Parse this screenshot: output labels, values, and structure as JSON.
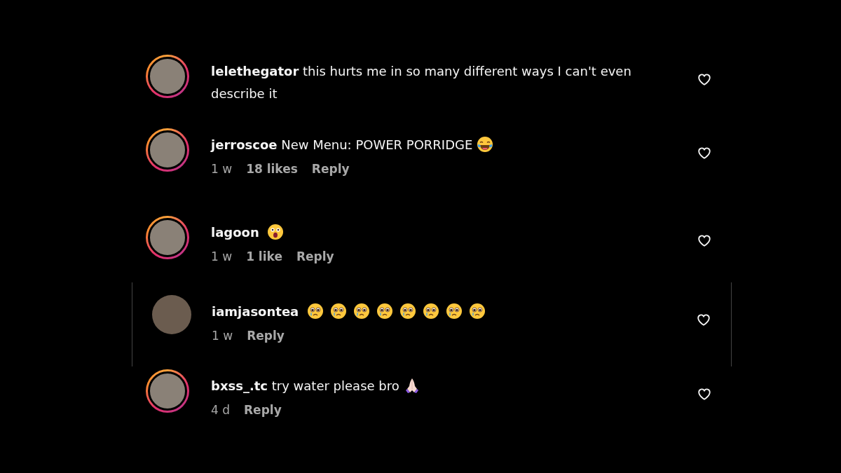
{
  "comments": [
    {
      "username": "lelethegator",
      "text": "this hurts me in so many different ways I can't even describe it",
      "story_ring": true,
      "highlighted": false
    },
    {
      "username": "jerroscoe",
      "text": "New Menu: POWER PORRIDGE",
      "emojis": [
        {
          "kind": "laughing"
        }
      ],
      "story_ring": true,
      "highlighted": false,
      "meta": [
        "1 w",
        "18 likes"
      ],
      "reply": "Reply"
    },
    {
      "username": "lagoon",
      "emojis": [
        {
          "kind": "astonished"
        }
      ],
      "story_ring": true,
      "highlighted": false,
      "meta": [
        "1 w",
        "1 like"
      ],
      "reply": "Reply"
    },
    {
      "username": "iamjasontea",
      "emojis": [
        {
          "kind": "crying"
        },
        {
          "kind": "crying"
        },
        {
          "kind": "crying"
        },
        {
          "kind": "crying"
        },
        {
          "kind": "crying"
        },
        {
          "kind": "crying"
        },
        {
          "kind": "crying"
        },
        {
          "kind": "crying"
        }
      ],
      "story_ring": false,
      "highlighted": true,
      "meta": [
        "1 w"
      ],
      "reply": "Reply"
    },
    {
      "username": "bxss_.tc",
      "text": "try water please bro",
      "emojis": [
        {
          "kind": "folded-hands"
        }
      ],
      "story_ring": true,
      "highlighted": false,
      "meta": [
        "4 d"
      ],
      "reply": "Reply"
    }
  ]
}
